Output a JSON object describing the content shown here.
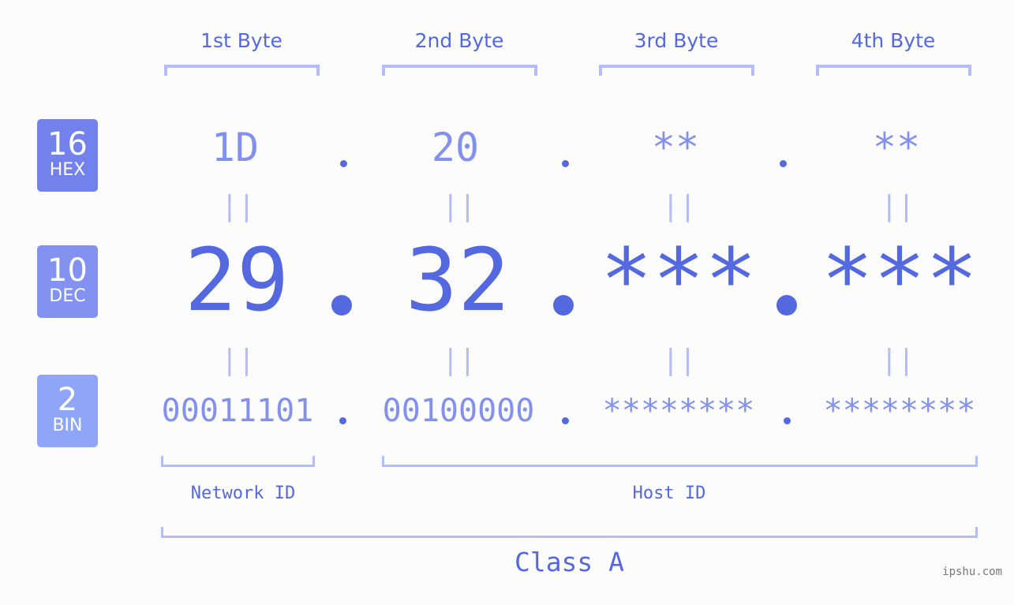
{
  "badges": [
    {
      "number": "16",
      "label": "HEX",
      "color": "#7281eb"
    },
    {
      "number": "10",
      "label": "DEC",
      "color": "#8392f0"
    },
    {
      "number": "2",
      "label": "BIN",
      "color": "#8fa6f8"
    }
  ],
  "bytes": [
    {
      "header": "1st Byte",
      "hex": "1D",
      "dec": "29",
      "bin": "00011101"
    },
    {
      "header": "2nd Byte",
      "hex": "20",
      "dec": "32",
      "bin": "00100000"
    },
    {
      "header": "3rd Byte",
      "hex": "**",
      "dec": "***",
      "bin": "********"
    },
    {
      "header": "4th Byte",
      "hex": "**",
      "dec": "***",
      "bin": "********"
    }
  ],
  "equals_glyph": "||",
  "network_id_label": "Network ID",
  "host_id_label": "Host ID",
  "class_label": "Class A",
  "credit": "ipshu.com",
  "colors": {
    "primary": "#5468e0",
    "secondary": "#8290ee",
    "bracket": "#b4bdf8",
    "background": "#fbfcfb"
  }
}
